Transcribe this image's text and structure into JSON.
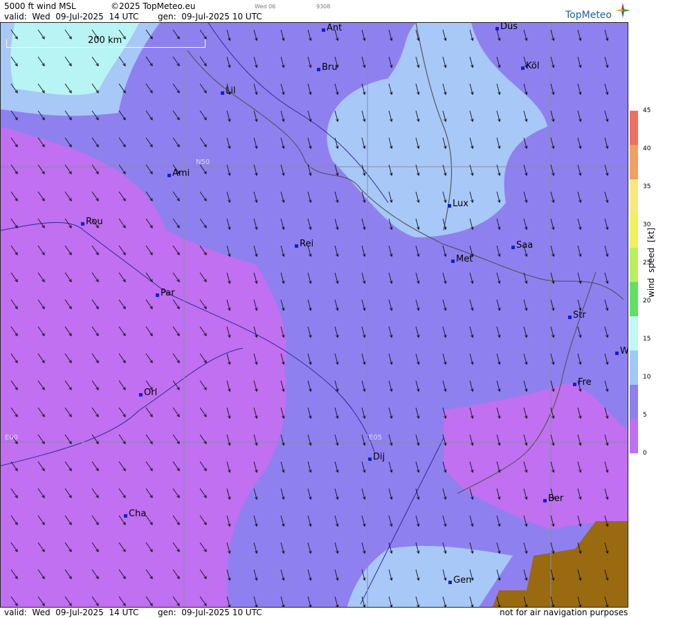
{
  "header": {
    "product": "5000 ft wind MSL",
    "copyright": "©2025 TopMeteo.eu",
    "tag1": "Wed 06",
    "tag2": "9308",
    "valid": "valid:  Wed  09-Jul-2025  14 UTC",
    "generated": "gen:  09-Jul-2025 10 UTC"
  },
  "logo": {
    "text": "TopMeteo"
  },
  "scale_bar": {
    "label": "200 km"
  },
  "grid_labels": {
    "n50": "N50",
    "e00": "E00",
    "e05": "E05"
  },
  "cities": [
    {
      "id": "ant",
      "label": "Ant"
    },
    {
      "id": "dus",
      "label": "Düs"
    },
    {
      "id": "bru",
      "label": "Bru"
    },
    {
      "id": "kol",
      "label": "Köl"
    },
    {
      "id": "lil",
      "label": "Lil"
    },
    {
      "id": "ami",
      "label": "Ami"
    },
    {
      "id": "rou",
      "label": "Rou"
    },
    {
      "id": "lux",
      "label": "Lux"
    },
    {
      "id": "rei",
      "label": "Rei"
    },
    {
      "id": "saa",
      "label": "Saa"
    },
    {
      "id": "met",
      "label": "Met"
    },
    {
      "id": "par",
      "label": "Par"
    },
    {
      "id": "str",
      "label": "Str"
    },
    {
      "id": "w",
      "label": "W"
    },
    {
      "id": "fre",
      "label": "Fre"
    },
    {
      "id": "orl",
      "label": "Orl"
    },
    {
      "id": "dij",
      "label": "Dij"
    },
    {
      "id": "ber",
      "label": "Ber"
    },
    {
      "id": "cha",
      "label": "Cha"
    },
    {
      "id": "gen",
      "label": "Gen"
    }
  ],
  "legend": {
    "title": "wind  speed  [kt]",
    "ticks": [
      "45",
      "40",
      "35",
      "30",
      "25",
      "20",
      "15",
      "10",
      "5",
      "0"
    ],
    "colors": [
      "#f07060",
      "#f0a060",
      "#f8e880",
      "#f0f060",
      "#b8f060",
      "#60e060",
      "#c0f8f8",
      "#a0c8f8",
      "#8f80f0",
      "#c070f0"
    ]
  },
  "footer": {
    "valid": "valid:  Wed  09-Jul-2025  14 UTC",
    "generated": "gen:  09-Jul-2025 10 UTC",
    "disclaimer": "not for air navigation purposes"
  }
}
